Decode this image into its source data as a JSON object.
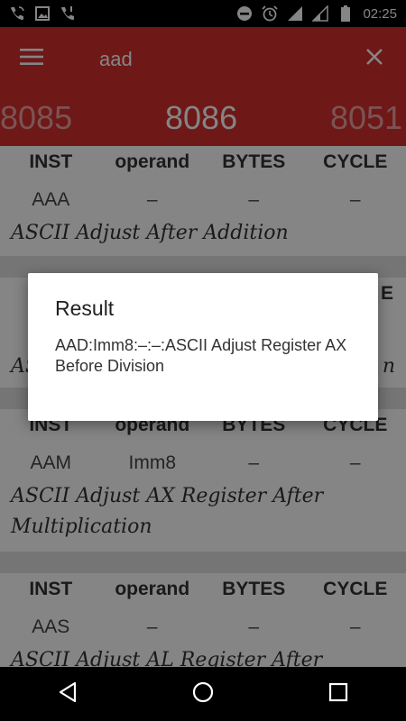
{
  "status_bar": {
    "time": "02:25",
    "left_icons": [
      "phone-wifi-icon",
      "image-icon",
      "phone-alert-icon"
    ],
    "right_icons": [
      "do-not-disturb-icon",
      "alarm-icon",
      "signal-icon",
      "signal-empty-icon",
      "battery-icon"
    ]
  },
  "app_bar": {
    "menu_icon": "hamburger-menu-icon",
    "search_value": "aad",
    "clear_icon": "close-icon"
  },
  "tabs": [
    {
      "label": "8085",
      "active": false
    },
    {
      "label": "8086",
      "active": true
    },
    {
      "label": "8051",
      "active": false
    }
  ],
  "columns": [
    "INST",
    "operand",
    "BYTES",
    "CYCLE"
  ],
  "instructions": [
    {
      "inst": "AAA",
      "operand": "–",
      "bytes": "–",
      "cycle": "–",
      "description": "ASCII Adjust After Addition"
    },
    {
      "inst": "AAM",
      "operand": "Imm8",
      "bytes": "–",
      "cycle": "–",
      "description": "ASCII Adjust AX Register After Multiplication"
    },
    {
      "inst": "AAS",
      "operand": "–",
      "bytes": "–",
      "cycle": "–",
      "description": "ASCII Adjust AL Register After"
    }
  ],
  "dialog": {
    "title": "Result",
    "message": "AAD:Imm8:–:–:ASCII Adjust Register AX Before Division"
  },
  "partial_visible": {
    "card2_letter_e": "E",
    "card2_desc_start": "AS",
    "card2_desc_end": "n"
  },
  "nav_bar": {
    "icons": [
      "back-icon",
      "home-icon",
      "recents-icon"
    ]
  },
  "colors": {
    "primary": "#d32f2f",
    "overlay": "rgba(0,0,0,0.48)"
  }
}
